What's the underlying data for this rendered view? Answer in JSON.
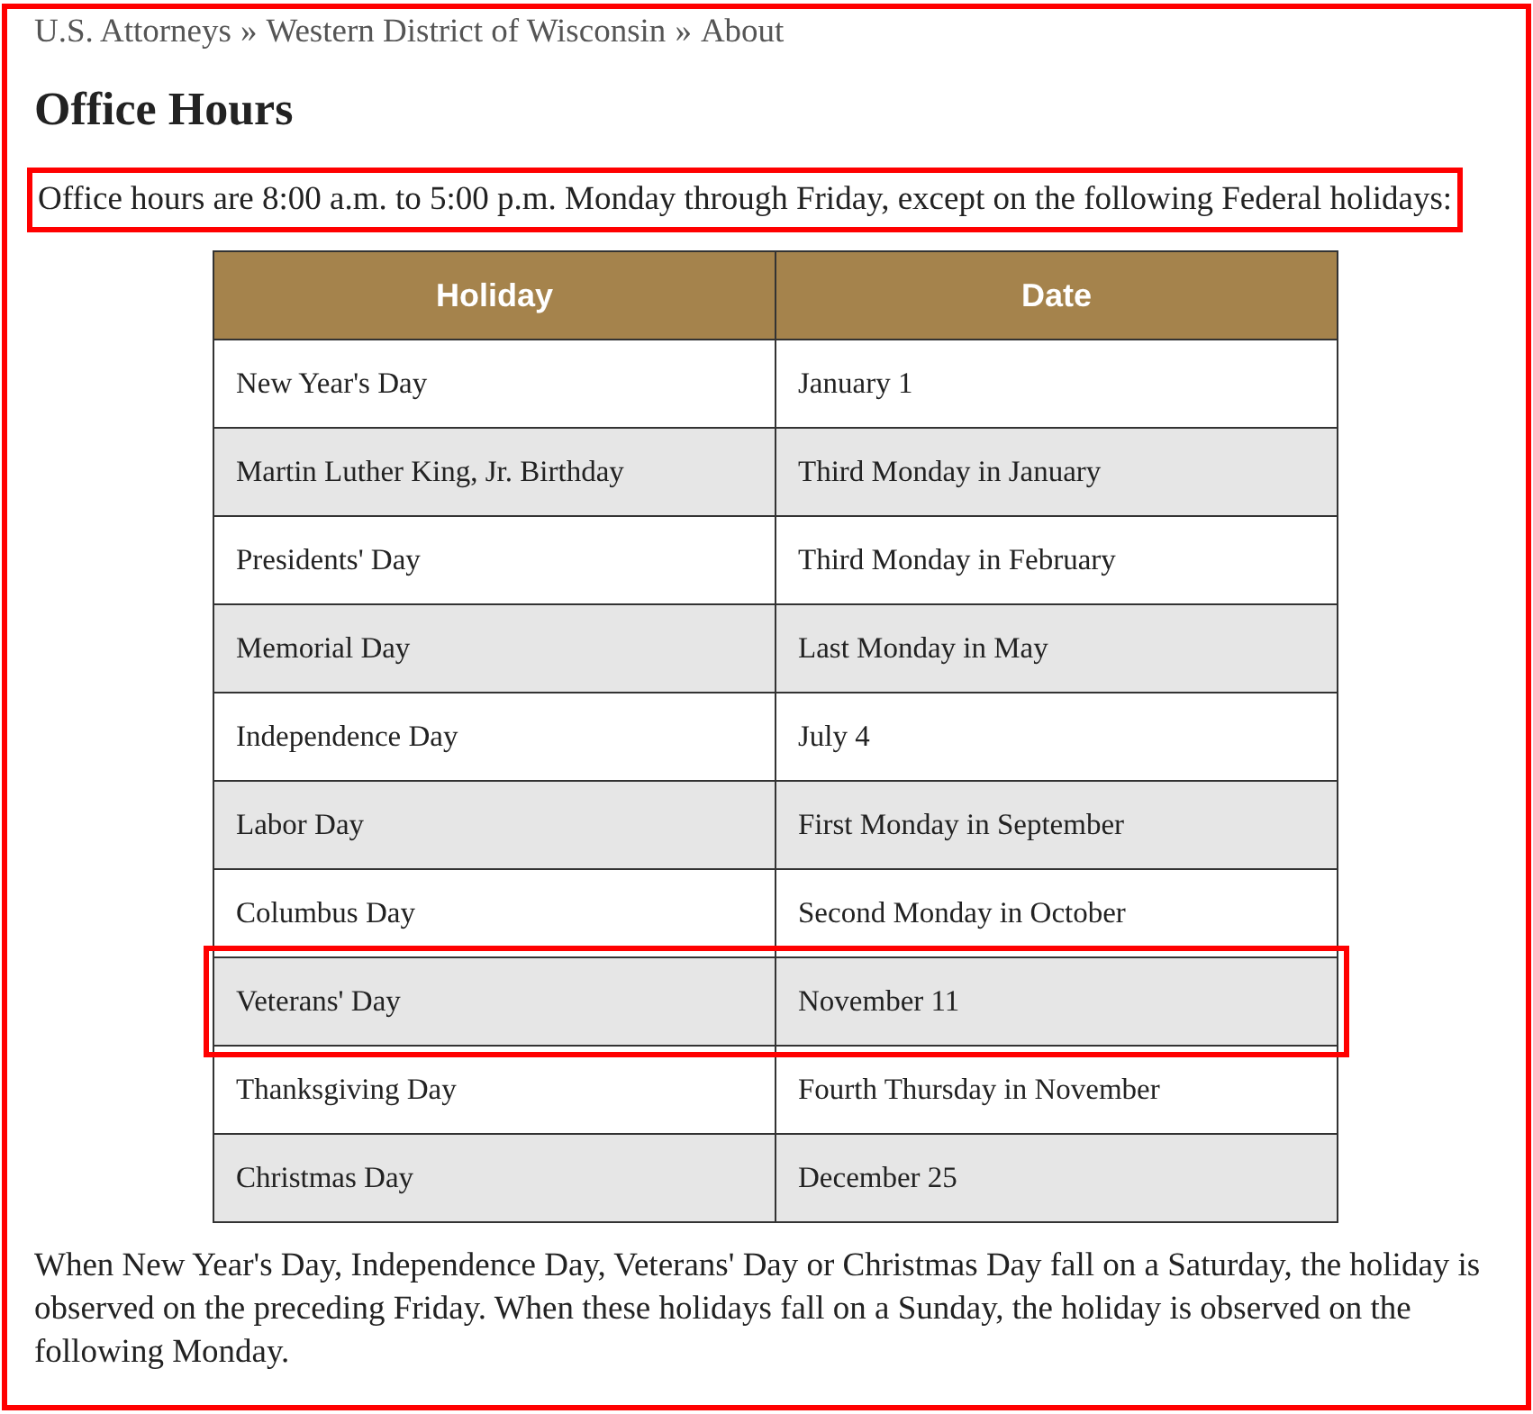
{
  "page": {
    "highlighted": true
  },
  "breadcrumb": [
    "U.S. Attorneys",
    "Western District of Wisconsin",
    "About"
  ],
  "breadcrumb_separator": "»",
  "heading": "Office Hours",
  "intro": {
    "text": "Office hours are 8:00 a.m. to 5:00 p.m. Monday through Friday, except on the following Federal holidays:",
    "highlighted": true
  },
  "table": {
    "columns": [
      "Holiday",
      "Date"
    ],
    "rows": [
      {
        "cells": [
          "New Year's Day",
          "January 1"
        ],
        "highlighted": false
      },
      {
        "cells": [
          "Martin Luther King, Jr. Birthday",
          "Third Monday in January"
        ],
        "highlighted": false
      },
      {
        "cells": [
          "Presidents' Day",
          "Third Monday in February"
        ],
        "highlighted": false
      },
      {
        "cells": [
          "Memorial Day",
          "Last Monday in May"
        ],
        "highlighted": false
      },
      {
        "cells": [
          "Independence Day",
          "July 4"
        ],
        "highlighted": false
      },
      {
        "cells": [
          "Labor Day",
          "First Monday in September"
        ],
        "highlighted": false
      },
      {
        "cells": [
          "Columbus Day",
          "Second Monday in October"
        ],
        "highlighted": false
      },
      {
        "cells": [
          "Veterans' Day",
          "November 11"
        ],
        "highlighted": true
      },
      {
        "cells": [
          "Thanksgiving Day",
          "Fourth Thursday in November"
        ],
        "highlighted": false
      },
      {
        "cells": [
          "Christmas Day",
          "December 25"
        ],
        "highlighted": false
      }
    ]
  },
  "note": "When New Year's Day, Independence Day, Veterans' Day or Christmas Day fall on a Saturday, the holiday is observed on the preceding Friday. When these holidays fall on a Sunday, the holiday is observed on the following Monday."
}
